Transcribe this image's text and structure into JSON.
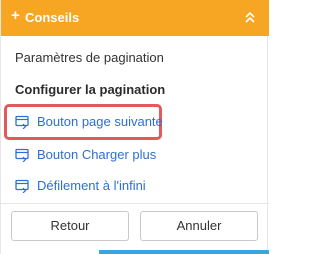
{
  "header": {
    "title": "Conseils",
    "plus_icon": "+",
    "collapse_icon": "chevron-double-up-icon",
    "background_color": "#f7a623"
  },
  "menu": {
    "pagination_settings": "Paramètres de pagination",
    "section_title": "Configurer la pagination",
    "options": [
      {
        "label": "Bouton page suivante",
        "icon": "pagination-option-icon",
        "highlighted": true
      },
      {
        "label": "Bouton Charger plus",
        "icon": "pagination-option-icon",
        "highlighted": false
      },
      {
        "label": "Défilement à l'infini",
        "icon": "pagination-option-icon",
        "highlighted": false
      }
    ]
  },
  "footer": {
    "back_label": "Retour",
    "cancel_label": "Annuler"
  },
  "colors": {
    "accent": "#f7a623",
    "link": "#2f6fd0",
    "highlight": "#e25a5a"
  }
}
